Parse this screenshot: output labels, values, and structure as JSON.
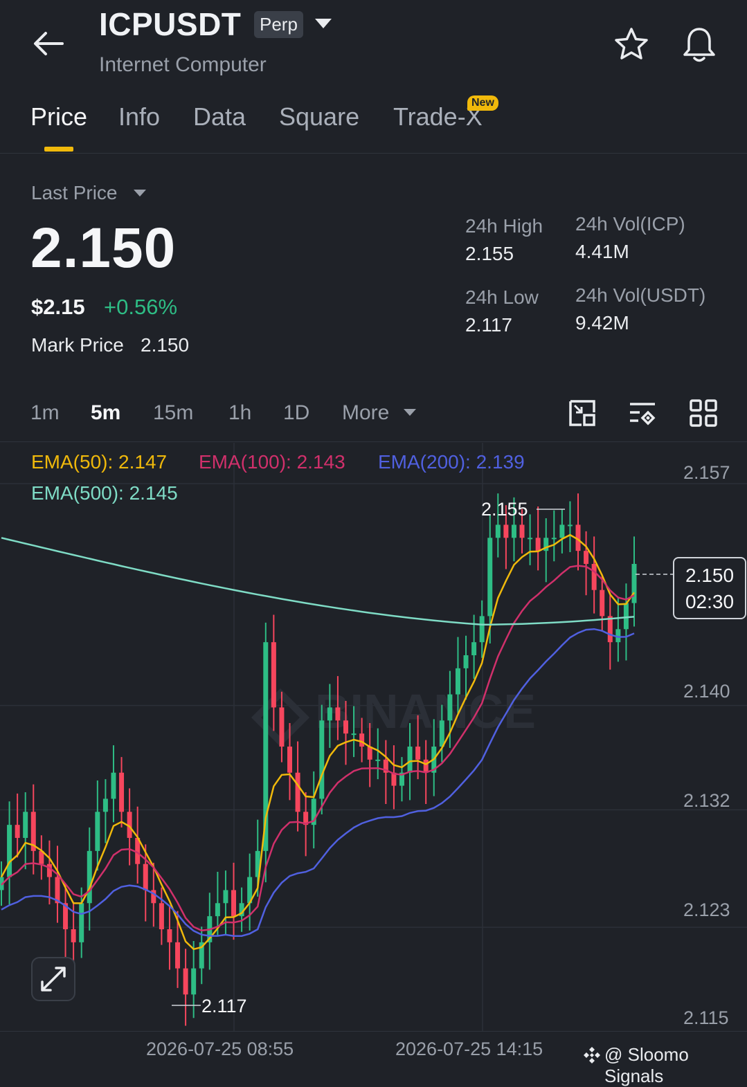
{
  "header": {
    "symbol": "ICPUSDT",
    "contract_type": "Perp",
    "name": "Internet Computer"
  },
  "tabs": [
    {
      "label": "Price",
      "active": true
    },
    {
      "label": "Info"
    },
    {
      "label": "Data"
    },
    {
      "label": "Square"
    },
    {
      "label": "Trade-X",
      "badge": "New"
    }
  ],
  "price_panel": {
    "last_price_label": "Last Price",
    "last_price": "2.150",
    "usd_price": "$2.15",
    "change_pct": "+0.56%",
    "mark_price_label": "Mark Price",
    "mark_price": "2.150",
    "high_label": "24h High",
    "high_value": "2.155",
    "low_label": "24h Low",
    "low_value": "2.117",
    "vol_icp_label": "24h Vol(ICP)",
    "vol_icp_value": "4.41M",
    "vol_usdt_label": "24h Vol(USDT)",
    "vol_usdt_value": "9.42M"
  },
  "intervals": [
    "1m",
    "5m",
    "15m",
    "1h",
    "1D"
  ],
  "active_interval": "5m",
  "more_label": "More",
  "colors": {
    "up": "#2ebd85",
    "down": "#f6465d",
    "ema50": "#f0b90b",
    "ema100": "#d0306b",
    "ema200": "#5060e0",
    "ema500": "#7fdcc6",
    "accent": "#f0b90b"
  },
  "chart_data": {
    "type": "candlestick",
    "indicators": [
      {
        "label": "EMA(50): 2.147",
        "name": "EMA(50)",
        "value": 2.147
      },
      {
        "label": "EMA(100): 2.143",
        "name": "EMA(100)",
        "value": 2.143
      },
      {
        "label": "EMA(200): 2.139",
        "name": "EMA(200)",
        "value": 2.139
      },
      {
        "label": "EMA(500): 2.145",
        "name": "EMA(500)",
        "value": 2.145
      }
    ],
    "y_ticks": [
      "2.157",
      "2.140",
      "2.132",
      "2.123",
      "2.115"
    ],
    "y_tick_values": [
      2.157,
      2.14,
      2.132,
      2.123,
      2.115
    ],
    "ylim": [
      2.115,
      2.157
    ],
    "x_ticks": [
      "2026-07-25 08:55",
      "2026-07-25 14:15"
    ],
    "high_marker": "2.155",
    "low_marker": "2.117",
    "current_price": "2.150",
    "countdown": "02:30",
    "candles_close": [
      2.126,
      2.13,
      2.129,
      2.131,
      2.128,
      2.127,
      2.126,
      2.124,
      2.122,
      2.121,
      2.124,
      2.128,
      2.131,
      2.132,
      2.134,
      2.131,
      2.129,
      2.127,
      2.125,
      2.124,
      2.122,
      2.121,
      2.119,
      2.117,
      2.119,
      2.121,
      2.123,
      2.124,
      2.125,
      2.123,
      2.124,
      2.126,
      2.128,
      2.144,
      2.139,
      2.136,
      2.134,
      2.131,
      2.13,
      2.132,
      2.138,
      2.139,
      2.138,
      2.137,
      2.137,
      2.136,
      2.135,
      2.135,
      2.134,
      2.133,
      2.134,
      2.136,
      2.135,
      2.134,
      2.136,
      2.138,
      2.14,
      2.142,
      2.143,
      2.144,
      2.146,
      2.152,
      2.153,
      2.152,
      2.153,
      2.152,
      2.152,
      2.151,
      2.152,
      2.152,
      2.153,
      2.153,
      2.151,
      2.15,
      2.148,
      2.146,
      2.144,
      2.145,
      2.147,
      2.15
    ]
  },
  "watermark": "BINANCE",
  "footer_credit": "@ Sloomo Signals"
}
